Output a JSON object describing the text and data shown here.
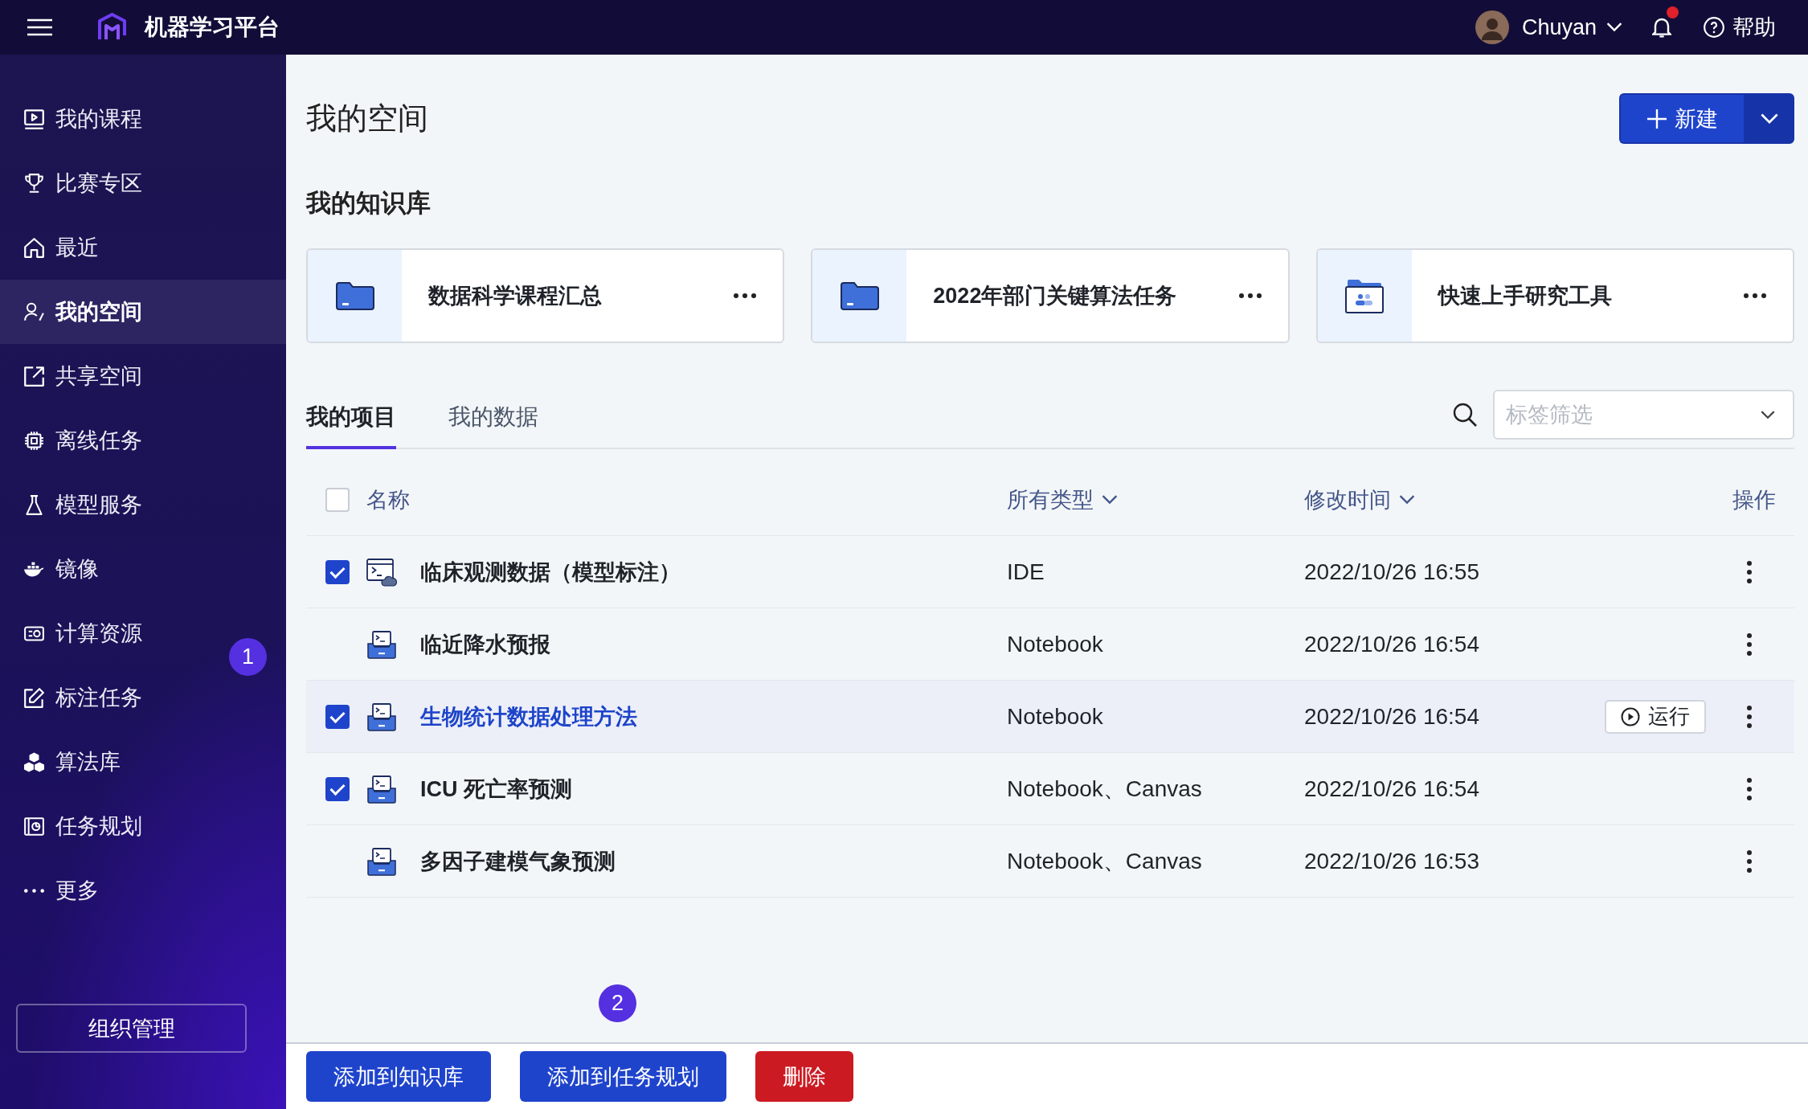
{
  "top_bar": {
    "app_title": "机器学习平台",
    "user_name": "Chuyan",
    "has_notification": true,
    "help_label": "帮助"
  },
  "sidebar": {
    "items": [
      {
        "label": "我的课程",
        "selected": false
      },
      {
        "label": "比赛专区",
        "selected": false
      },
      {
        "label": "最近",
        "selected": false
      },
      {
        "label": "我的空间",
        "selected": true
      },
      {
        "label": "共享空间",
        "selected": false
      },
      {
        "label": "离线任务",
        "selected": false
      },
      {
        "label": "模型服务",
        "selected": false
      },
      {
        "label": "镜像",
        "selected": false
      },
      {
        "label": "计算资源",
        "selected": false
      },
      {
        "label": "标注任务",
        "selected": false
      },
      {
        "label": "算法库",
        "selected": false
      },
      {
        "label": "任务规划",
        "selected": false
      },
      {
        "label": "更多",
        "selected": false
      }
    ],
    "org_button": "组织管理",
    "marker": "1"
  },
  "page": {
    "title": "我的空间",
    "new_button": "新建"
  },
  "knowledge_base": {
    "heading": "我的知识库",
    "cards": [
      {
        "title": "数据科学课程汇总",
        "kind": "folder"
      },
      {
        "title": "2022年部门关键算法任务",
        "kind": "folder"
      },
      {
        "title": "快速上手研究工具",
        "kind": "team_folder"
      }
    ]
  },
  "tabs": [
    {
      "label": "我的项目",
      "selected": true
    },
    {
      "label": "我的数据",
      "selected": false
    }
  ],
  "tag_filter": {
    "placeholder": "标签筛选"
  },
  "table": {
    "select_all": {
      "checked": false
    },
    "columns": [
      {
        "label": "名称",
        "has_dropdown": false
      },
      {
        "label": "所有类型",
        "has_dropdown": true
      },
      {
        "label": "修改时间",
        "has_dropdown": true
      },
      {
        "label": "操作",
        "has_dropdown": false
      }
    ],
    "rows": [
      {
        "name": "临床观测数据（模型标注）",
        "kind": "ide",
        "type": "IDE",
        "modified": "2022/10/26 16:55",
        "checked": true,
        "highlighted": false
      },
      {
        "name": "临近降水预报",
        "kind": "notebook",
        "type": "Notebook",
        "modified": "2022/10/26 16:54",
        "checked": false,
        "highlighted": false
      },
      {
        "name": "生物统计数据处理方法",
        "kind": "notebook",
        "type": "Notebook",
        "modified": "2022/10/26 16:54",
        "checked": true,
        "highlighted": true,
        "run_label": "运行"
      },
      {
        "name": "ICU 死亡率预测",
        "kind": "notebook",
        "type": "Notebook、Canvas",
        "modified": "2022/10/26 16:54",
        "checked": true,
        "highlighted": false
      },
      {
        "name": "多因子建模气象预测",
        "kind": "notebook",
        "type": "Notebook、Canvas",
        "modified": "2022/10/26 16:53",
        "checked": false,
        "highlighted": false
      }
    ]
  },
  "bottom_bar": {
    "buttons": [
      {
        "label": "添加到知识库",
        "kind": "primary"
      },
      {
        "label": "添加到任务规划",
        "kind": "primary"
      },
      {
        "label": "删除",
        "kind": "danger"
      }
    ],
    "marker": "2"
  }
}
